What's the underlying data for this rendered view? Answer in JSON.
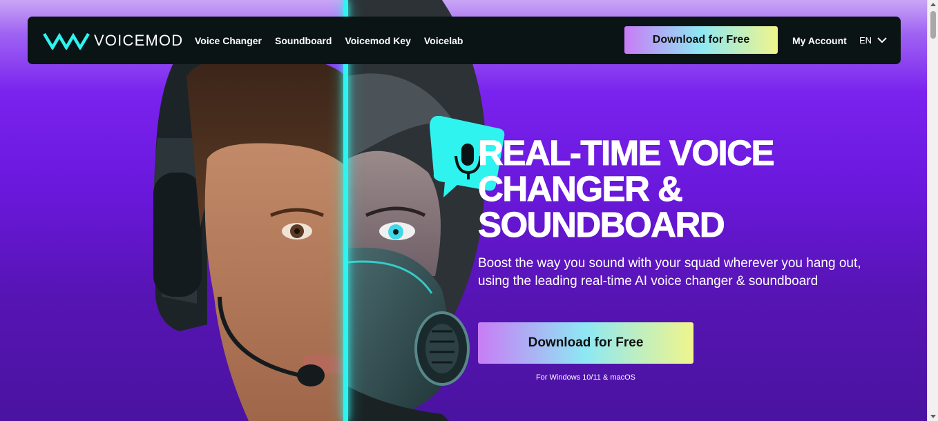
{
  "brand": {
    "name": "VOICEMOD"
  },
  "nav": {
    "links": [
      "Voice Changer",
      "Soundboard",
      "Voicemod Key",
      "Voicelab"
    ],
    "cta": "Download for Free",
    "account": "My Account",
    "language": "EN"
  },
  "hero": {
    "headline": "REAL-TIME VOICE CHANGER & SOUNDBOARD",
    "subtext": "Boost the way you sound with your squad wherever you hang out, using the leading real-time AI voice changer & soundboard",
    "cta": "Download for Free",
    "platform_note": "For Windows 10/11 & macOS"
  },
  "colors": {
    "accent_cyan": "#2ff3ee",
    "nav_bg": "#0a1414",
    "cta_gradient": [
      "#c87cf5",
      "#8ee8f3",
      "#f0f58c"
    ],
    "hero_bg": "#6a18dc"
  },
  "icons": [
    "voicemod-logo-icon",
    "chevron-down-icon",
    "microphone-icon"
  ]
}
